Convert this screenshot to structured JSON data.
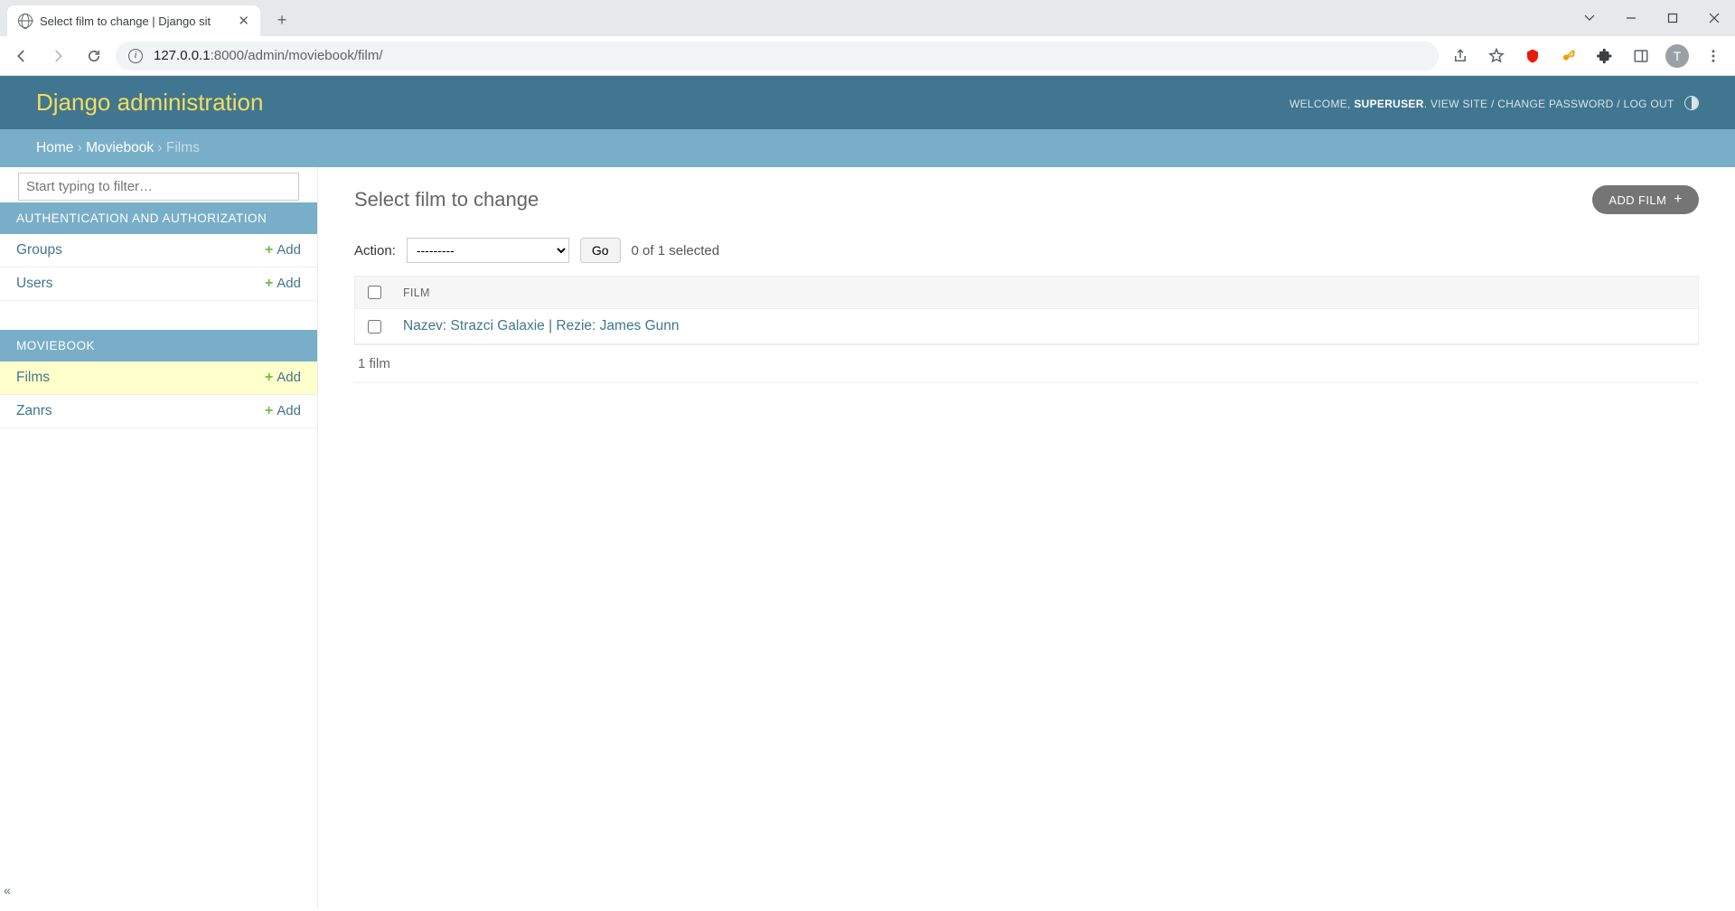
{
  "browser": {
    "tab_title": "Select film to change | Django sit",
    "url_host": "127.0.0.1",
    "url_port": ":8000",
    "url_path": "/admin/moviebook/film/",
    "avatar_letter": "T"
  },
  "header": {
    "branding": "Django administration",
    "welcome": "WELCOME, ",
    "username": "SUPERUSER",
    "view_site": "VIEW SITE",
    "change_password": "CHANGE PASSWORD",
    "log_out": "LOG OUT"
  },
  "breadcrumbs": {
    "home": "Home",
    "app": "Moviebook",
    "model": "Films"
  },
  "sidebar": {
    "filter_placeholder": "Start typing to filter…",
    "add_label": "Add",
    "apps": [
      {
        "caption": "AUTHENTICATION AND AUTHORIZATION",
        "models": [
          {
            "name": "Groups",
            "active": false
          },
          {
            "name": "Users",
            "active": false
          }
        ]
      },
      {
        "caption": "MOVIEBOOK",
        "models": [
          {
            "name": "Films",
            "active": true
          },
          {
            "name": "Zanrs",
            "active": false
          }
        ]
      }
    ]
  },
  "content": {
    "title": "Select film to change",
    "add_button": "ADD FILM",
    "action_label": "Action:",
    "action_placeholder": "---------",
    "go_label": "Go",
    "selection_text": "0 of 1 selected",
    "column_header": "FILM",
    "rows": [
      {
        "text": "Nazev: Strazci Galaxie | Rezie: James Gunn"
      }
    ],
    "total": "1 film"
  }
}
